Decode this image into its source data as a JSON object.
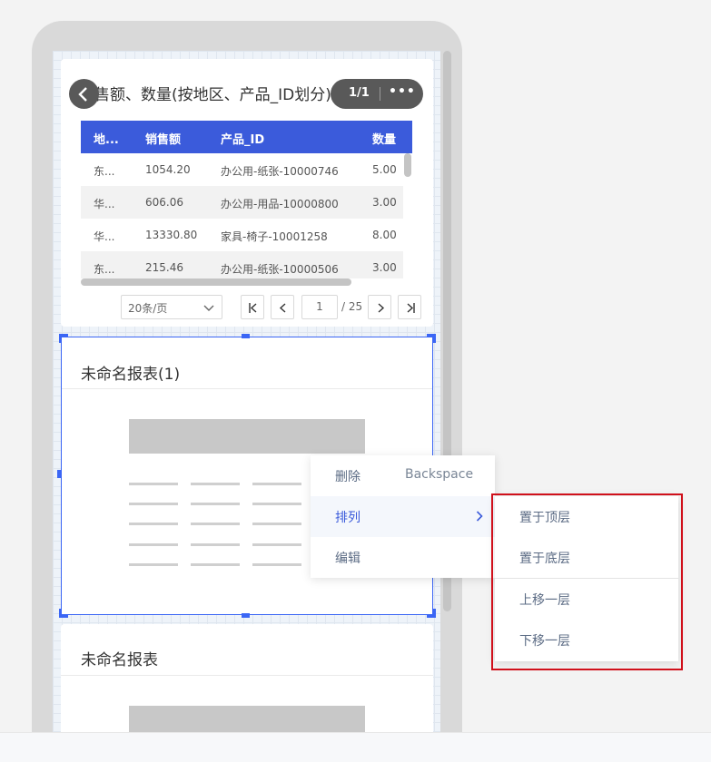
{
  "widget1": {
    "title": "销售额、数量(按地区、产品_ID划分)",
    "page_indicator": "1/1",
    "more_label": "•••",
    "table": {
      "headers": [
        "地...",
        "销售额",
        "产品_ID",
        "数量"
      ],
      "rows": [
        [
          "东...",
          "1054.20",
          "办公用-纸张-10000746",
          "5.00"
        ],
        [
          "华...",
          "606.06",
          "办公用-用品-10000800",
          "3.00"
        ],
        [
          "华...",
          "13330.80",
          "家具-椅子-10001258",
          "8.00"
        ],
        [
          "东...",
          "215.46",
          "办公用-纸张-10000506",
          "3.00"
        ]
      ]
    },
    "pagination": {
      "page_size": "20条/页",
      "current_page": "1",
      "total": "/ 25"
    }
  },
  "widget2": {
    "title": "未命名报表(1)"
  },
  "widget3": {
    "title": "未命名报表"
  },
  "context_menu": {
    "items": [
      {
        "label": "删除",
        "shortcut": "Backspace"
      },
      {
        "label": "排列"
      },
      {
        "label": "编辑"
      }
    ]
  },
  "submenu": {
    "items": [
      {
        "label": "置于顶层"
      },
      {
        "label": "置于底层"
      },
      {
        "label": "上移一层"
      },
      {
        "label": "下移一层"
      }
    ]
  },
  "colors": {
    "table_header": "#3b5bdb",
    "selection": "#3b66f5",
    "highlight": "#d0101b"
  }
}
